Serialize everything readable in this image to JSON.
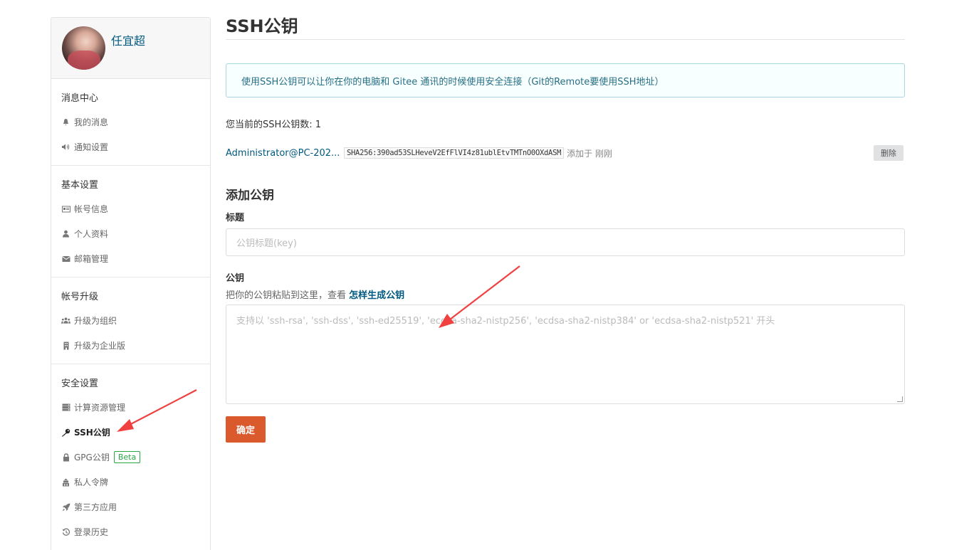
{
  "user": {
    "name": "任宜超"
  },
  "sidebar": {
    "sections": [
      {
        "title": "消息中心",
        "items": [
          {
            "label": "我的消息",
            "icon": "bell-icon"
          },
          {
            "label": "通知设置",
            "icon": "speaker-icon"
          }
        ]
      },
      {
        "title": "基本设置",
        "items": [
          {
            "label": "帐号信息",
            "icon": "id-card-icon"
          },
          {
            "label": "个人资料",
            "icon": "user-icon"
          },
          {
            "label": "邮箱管理",
            "icon": "envelope-icon"
          }
        ]
      },
      {
        "title": "帐号升级",
        "items": [
          {
            "label": "升级为组织",
            "icon": "users-icon"
          },
          {
            "label": "升级为企业版",
            "icon": "building-icon"
          }
        ]
      },
      {
        "title": "安全设置",
        "items": [
          {
            "label": "计算资源管理",
            "icon": "server-icon"
          },
          {
            "label": "SSH公钥",
            "icon": "key-icon",
            "active": true
          },
          {
            "label": "GPG公钥",
            "icon": "lock-icon",
            "badge": "Beta"
          },
          {
            "label": "私人令牌",
            "icon": "token-icon"
          },
          {
            "label": "第三方应用",
            "icon": "rocket-icon"
          },
          {
            "label": "登录历史",
            "icon": "history-icon"
          }
        ]
      }
    ]
  },
  "main": {
    "title": "SSH公钥",
    "info": "使用SSH公钥可以让你在你的电脑和 Gitee 通讯的时候使用安全连接（Git的Remote要使用SSH地址）",
    "count_text": "您当前的SSH公钥数: 1",
    "keys": [
      {
        "name": "Administrator@PC-202...",
        "fingerprint": "SHA256:390ad53SLHeveV2EfFlVI4z81ublEtvTMTnO0OXdASM",
        "added": "添加于 刚刚",
        "delete_label": "删除"
      }
    ],
    "add_title": "添加公钥",
    "title_label": "标题",
    "title_placeholder": "公钥标题(key)",
    "key_label": "公钥",
    "key_hint": "把你的公钥粘贴到这里，查看 ",
    "key_hint_link": "怎样生成公钥",
    "key_placeholder": "支持以 'ssh-rsa', 'ssh-dss', 'ssh-ed25519', 'ecdsa-sha2-nistp256', 'ecdsa-sha2-nistp384' or 'ecdsa-sha2-nistp521' 开头",
    "submit_label": "确定"
  },
  "colors": {
    "accent": "#da5a2e",
    "link": "#005980",
    "info_border": "#a9d5de",
    "annotation_arrow": "#f04040"
  }
}
